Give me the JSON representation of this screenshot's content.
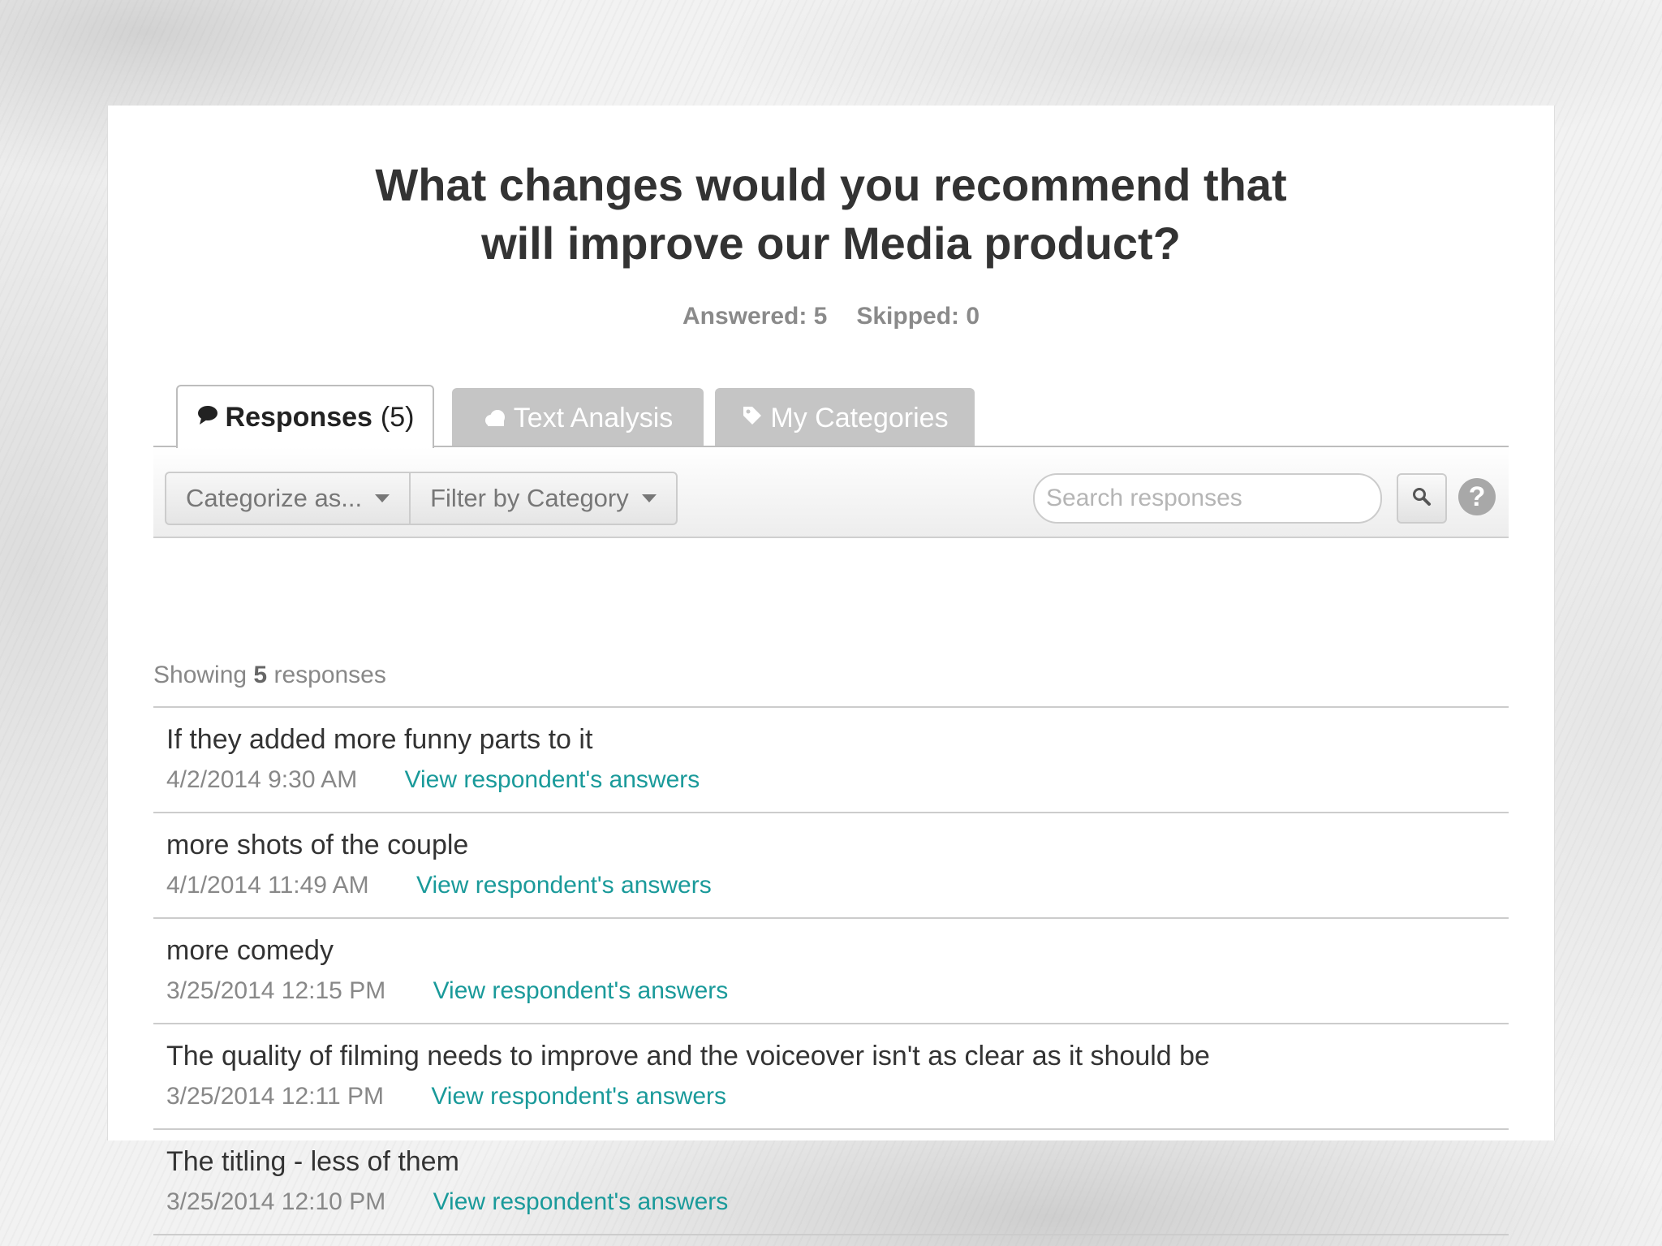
{
  "question": {
    "title_line1": "What changes would you recommend that",
    "title_line2": "will improve our Media product?",
    "answered": "Answered: 5",
    "skipped": "Skipped: 0"
  },
  "tabs": [
    {
      "label": "Responses",
      "count": "(5)",
      "icon": "speech-bubble-icon",
      "active": true
    },
    {
      "label": "Text Analysis",
      "icon": "cloud-icon",
      "active": false
    },
    {
      "label": "My Categories",
      "icon": "tag-icon",
      "active": false
    }
  ],
  "toolbar": {
    "categorize_label": "Categorize as...",
    "filter_label": "Filter by Category",
    "search_placeholder": "Search responses",
    "help_label": "?"
  },
  "summary": {
    "prefix": "Showing",
    "count": "5",
    "suffix": "responses"
  },
  "responses": [
    {
      "text": "If they added more funny parts to it",
      "date": "4/2/2014 9:30 AM",
      "link": "View respondent's answers"
    },
    {
      "text": "more shots of the couple",
      "date": "4/1/2014 11:49 AM",
      "link": "View respondent's answers"
    },
    {
      "text": "more comedy",
      "date": "3/25/2014 12:15 PM",
      "link": "View respondent's answers"
    },
    {
      "text": "The quality of filming needs to improve and the voiceover isn't as clear as it should be",
      "date": "3/25/2014 12:11 PM",
      "link": "View respondent's answers"
    },
    {
      "text": "The titling - less of them",
      "date": "3/25/2014 12:10 PM",
      "link": "View respondent's answers"
    }
  ],
  "colors": {
    "link": "#1a9a9a",
    "tab_inactive": "#c5c5c5",
    "title": "#333333"
  }
}
